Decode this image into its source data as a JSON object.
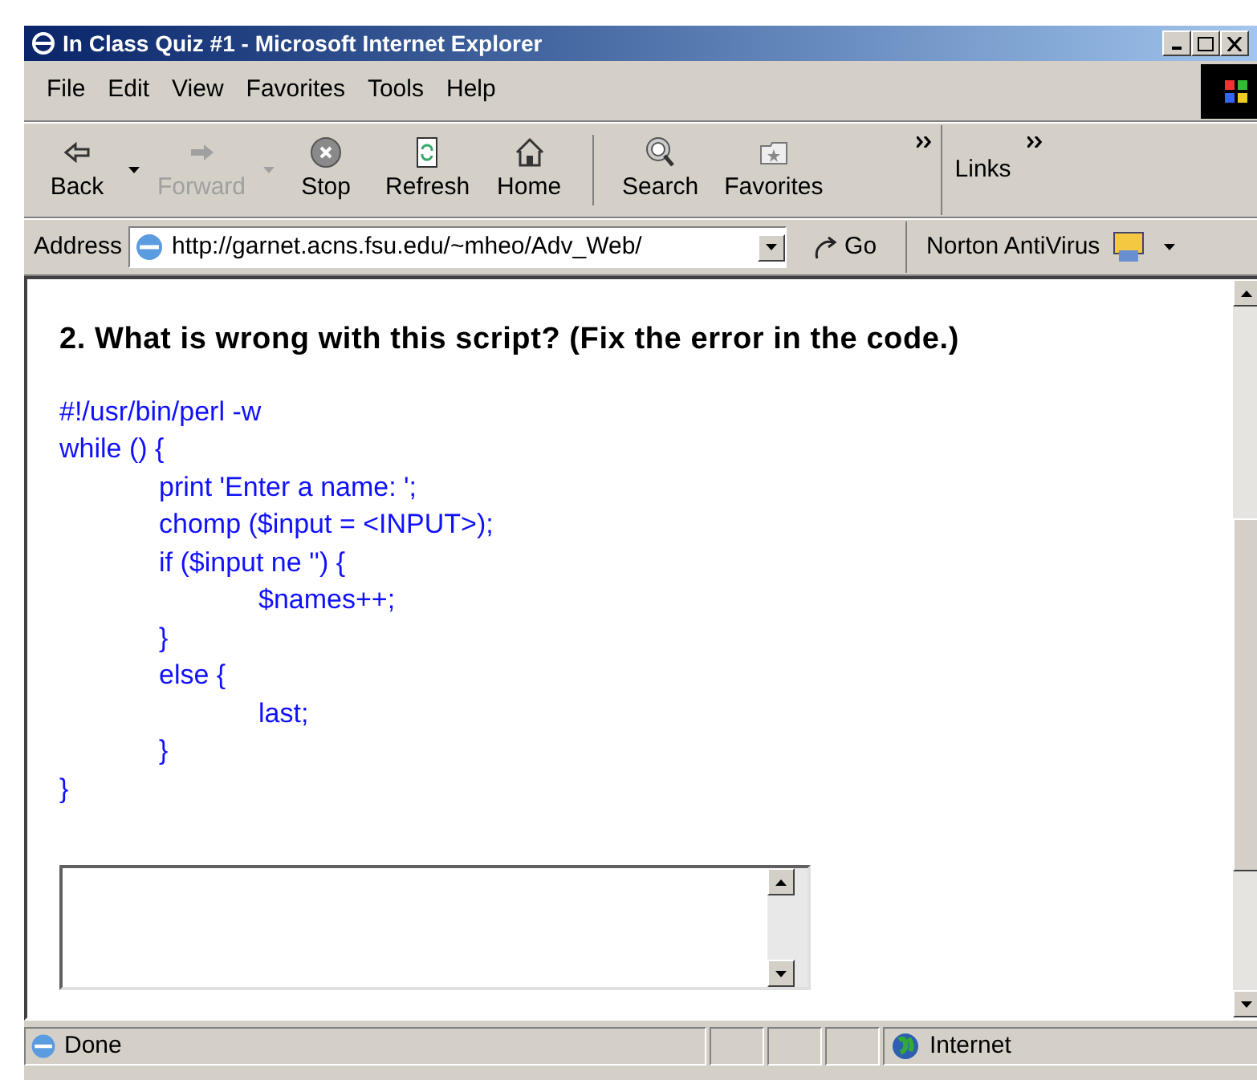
{
  "window": {
    "title": "In Class Quiz #1 - Microsoft Internet Explorer"
  },
  "menu": [
    "File",
    "Edit",
    "View",
    "Favorites",
    "Tools",
    "Help"
  ],
  "toolbar": [
    {
      "label": "Back",
      "kind": "back",
      "disabled": false,
      "dropdown": true
    },
    {
      "label": "Forward",
      "kind": "forward",
      "disabled": true,
      "dropdown": true
    },
    {
      "label": "Stop",
      "kind": "stop",
      "disabled": false,
      "dropdown": false
    },
    {
      "label": "Refresh",
      "kind": "refresh",
      "disabled": false,
      "dropdown": false
    },
    {
      "label": "Home",
      "kind": "home",
      "disabled": false,
      "dropdown": false
    },
    {
      "label": "Search",
      "kind": "search",
      "disabled": false,
      "dropdown": false
    },
    {
      "label": "Favorites",
      "kind": "favorites",
      "disabled": false,
      "dropdown": false
    }
  ],
  "links": "Links",
  "address": {
    "label": "Address",
    "value": "http://garnet.acns.fsu.edu/~mheo/Adv_Web/",
    "go": "Go",
    "norton": "Norton AntiVirus"
  },
  "question": "2. What is wrong with this script? (Fix the error in the code.)",
  "code": "#!/usr/bin/perl -w\nwhile () {\n\tprint 'Enter a name: ';\n\tchomp ($input = <INPUT>);\n\tif ($input ne '') {\n\t\t$names++;\n\t}\n\telse {\n\t\tlast;\n\t}\n}",
  "status_bar": {
    "text": "Done",
    "zone": "Internet"
  }
}
